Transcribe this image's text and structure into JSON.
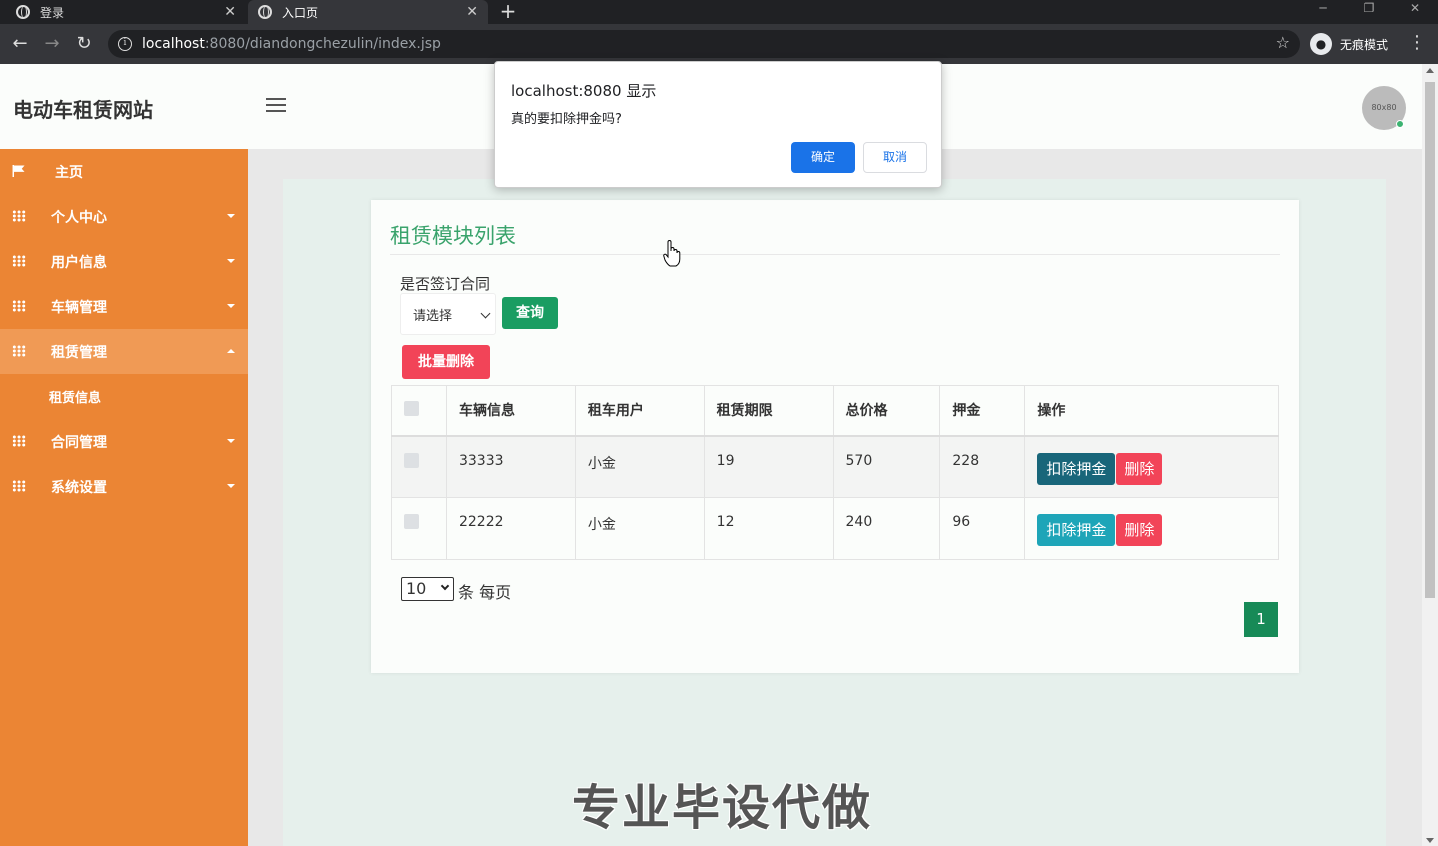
{
  "browser": {
    "tabs": [
      {
        "label": "登录"
      },
      {
        "label": "入口页"
      }
    ],
    "url_host": "localhost",
    "url_rest": ":8080/diandongchezulin/index.jsp",
    "incognito_label": "无痕模式"
  },
  "header": {
    "brand": "电动车租赁网站",
    "avatar_text": "80x80"
  },
  "sidebar": {
    "items": [
      {
        "label": "主页",
        "icon": "flag-icon"
      },
      {
        "label": "个人中心",
        "icon": "grid-icon"
      },
      {
        "label": "用户信息",
        "icon": "grid-icon"
      },
      {
        "label": "车辆管理",
        "icon": "grid-icon"
      },
      {
        "label": "租赁管理",
        "icon": "grid-icon"
      },
      {
        "label": "合同管理",
        "icon": "grid-icon"
      },
      {
        "label": "系统设置",
        "icon": "grid-icon"
      }
    ],
    "sub_items": [
      {
        "label": "租赁信息"
      }
    ]
  },
  "main": {
    "title": "租赁模块列表",
    "filter": {
      "label": "是否签订合同",
      "select_value": "请选择",
      "query_label": "查询"
    },
    "batch_delete_label": "批量删除",
    "table": {
      "headers": [
        "车辆信息",
        "租车用户",
        "租赁期限",
        "总价格",
        "押金",
        "操作"
      ],
      "rows": [
        {
          "vehicle": "33333",
          "user": "小金",
          "term": "19",
          "price": "570",
          "deposit": "228",
          "deduct_label": "扣除押金",
          "delete_label": "删除"
        },
        {
          "vehicle": "22222",
          "user": "小金",
          "term": "12",
          "price": "240",
          "deposit": "96",
          "deduct_label": "扣除押金",
          "delete_label": "删除"
        }
      ]
    },
    "pagination": {
      "page_size": "10",
      "per_page_label": "条 每页",
      "current_page": "1"
    },
    "watermark": "专业毕设代做"
  },
  "dialog": {
    "title": "localhost:8080 显示",
    "message": "真的要扣除押金吗?",
    "ok_label": "确定",
    "cancel_label": "取消"
  },
  "colors": {
    "sidebar": "#eb8534",
    "accent_green": "#3aa36c",
    "danger": "#f24458",
    "deduct_active": "#19667a",
    "deduct": "#1ea5b8",
    "dialog_primary": "#1a73e8"
  }
}
